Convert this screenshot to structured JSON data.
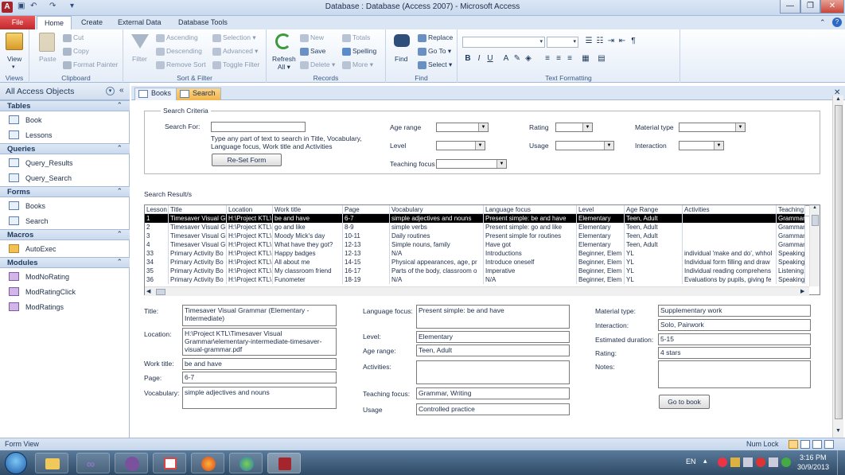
{
  "window": {
    "title": "Database : Database (Access 2007)  -  Microsoft Access"
  },
  "ribbon_tabs": [
    "File",
    "Home",
    "Create",
    "External Data",
    "Database Tools"
  ],
  "ribbon": {
    "views": {
      "view": "View",
      "label": "Views"
    },
    "clipboard": {
      "paste": "Paste",
      "cut": "Cut",
      "copy": "Copy",
      "format_painter": "Format Painter",
      "label": "Clipboard"
    },
    "sort_filter": {
      "filter": "Filter",
      "ascending": "Ascending",
      "descending": "Descending",
      "remove_sort": "Remove Sort",
      "selection": "Selection",
      "advanced": "Advanced",
      "toggle_filter": "Toggle Filter",
      "label": "Sort & Filter"
    },
    "records": {
      "refresh": "Refresh",
      "refresh2": "All",
      "new": "New",
      "save": "Save",
      "delete": "Delete",
      "totals": "Totals",
      "spelling": "Spelling",
      "more": "More",
      "label": "Records"
    },
    "find": {
      "find": "Find",
      "replace": "Replace",
      "goto": "Go To",
      "select": "Select",
      "label": "Find"
    },
    "text_formatting": {
      "label": "Text Formatting"
    }
  },
  "nav": {
    "title": "All Access Objects",
    "sections": [
      {
        "name": "Tables",
        "items": [
          "Book",
          "Lessons"
        ]
      },
      {
        "name": "Queries",
        "items": [
          "Query_Results",
          "Query_Search"
        ]
      },
      {
        "name": "Forms",
        "items": [
          "Books",
          "Search"
        ]
      },
      {
        "name": "Macros",
        "items": [
          "AutoExec"
        ]
      },
      {
        "name": "Modules",
        "items": [
          "ModNoRating",
          "ModRatingClick",
          "ModRatings"
        ]
      }
    ]
  },
  "doc_tabs": [
    "Books",
    "Search"
  ],
  "criteria": {
    "legend": "Search Criteria",
    "search_for": "Search For:",
    "hint": "Type any part of text to search in Title, Vocabulary, Language focus, Work title and Activities",
    "reset": "Re-Set Form",
    "age_range": "Age range",
    "level": "Level",
    "teaching_focus": "Teaching focus",
    "rating": "Rating",
    "usage": "Usage",
    "material_type": "Material type",
    "interaction": "Interaction"
  },
  "results_label": "Search Result/s",
  "grid": {
    "headers": [
      "Lesson",
      "Title",
      "Location",
      "Work title",
      "Page",
      "Vocabulary",
      "Language focus",
      "Level",
      "Age Range",
      "Activities",
      "Teaching f"
    ],
    "rows": [
      [
        "1",
        "Timesaver Visual Gi",
        "H:\\Project KTL\\",
        "be and have",
        "6-7",
        "simple adjectives and nouns",
        "Present simple: be and have",
        "Elementary",
        "Teen, Adult",
        "",
        "Grammar,"
      ],
      [
        "2",
        "Timesaver Visual Gi",
        "H:\\Project KTL\\",
        "go and like",
        "8-9",
        "simple verbs",
        "Present simple: go and like",
        "Elementary",
        "Teen, Adult",
        "",
        "Grammar,"
      ],
      [
        "3",
        "Timesaver Visual Gi",
        "H:\\Project KTL\\",
        "Moody Mick's day",
        "10-11",
        "Daily routines",
        "Present simple for routines",
        "Elementary",
        "Teen, Adult",
        "",
        "Grammar"
      ],
      [
        "4",
        "Timesaver Visual Gi",
        "H:\\Project KTL\\",
        "What have they got?",
        "12-13",
        "Simple nouns, family",
        "Have got",
        "Elementary",
        "Teen, Adult",
        "",
        "Grammar"
      ],
      [
        "33",
        "Primary Activity Bo",
        "H:\\Project KTL\\",
        "Happy badges",
        "12-13",
        "N/A",
        "Introductions",
        "Beginner, Elem",
        "YL",
        "individual 'make and do', whhol",
        "Speaking,"
      ],
      [
        "34",
        "Primary Activity Bo",
        "H:\\Project KTL\\",
        "All about me",
        "14-15",
        "Physical appearances, age, pr",
        "Introduce oneself",
        "Beginner, Elem",
        "YL",
        "Individual form filling and draw",
        "Speaking,"
      ],
      [
        "35",
        "Primary Activity Bo",
        "H:\\Project KTL\\",
        "My classroom friend",
        "16-17",
        "Parts of the body, classroom o",
        "Imperative",
        "Beginner, Elem",
        "YL",
        "Individual reading comprehens",
        "Listening,"
      ],
      [
        "36",
        "Primary Activity Bo",
        "H:\\Project KTL\\",
        "Funometer",
        "18-19",
        "N/A",
        "N/A",
        "Beginner, Elem",
        "YL",
        "Evaluations by pupils, giving fe",
        "Speaking"
      ]
    ]
  },
  "detail": {
    "title_lbl": "Title:",
    "title": "Timesaver Visual Grammar (Elementary - Intermediate)",
    "location_lbl": "Location:",
    "location": "H:\\Project KTL\\Timesaver Visual Grammar\\elementary-intermediate-timesaver-visual-grammar.pdf",
    "work_title_lbl": "Work title:",
    "work_title": "be and have",
    "page_lbl": "Page:",
    "page": "6-7",
    "vocab_lbl": "Vocabulary:",
    "vocab": "simple adjectives and nouns",
    "lang_lbl": "Language focus:",
    "lang": "Present simple: be and have",
    "level_lbl": "Level:",
    "level": "Elementary",
    "age_lbl": "Age range:",
    "age": "Teen, Adult",
    "act_lbl": "Activities:",
    "teach_lbl": "Teaching focus:",
    "teach": "Grammar, Writing",
    "usage_lbl": "Usage",
    "usage": "Controlled practice",
    "mat_lbl": "Material type:",
    "mat": "Supplementary work",
    "inter_lbl": "Interaction:",
    "inter": "Solo, Pairwork",
    "dur_lbl": "Estimated duration:",
    "dur": "5-15",
    "rating_lbl": "Rating:",
    "rating": "4 stars",
    "notes_lbl": "Notes:",
    "goto": "Go to book"
  },
  "status": {
    "left": "Form View",
    "numlock": "Num Lock"
  },
  "tray": {
    "lang": "EN",
    "time": "3:16 PM",
    "date": "30/9/2013"
  }
}
